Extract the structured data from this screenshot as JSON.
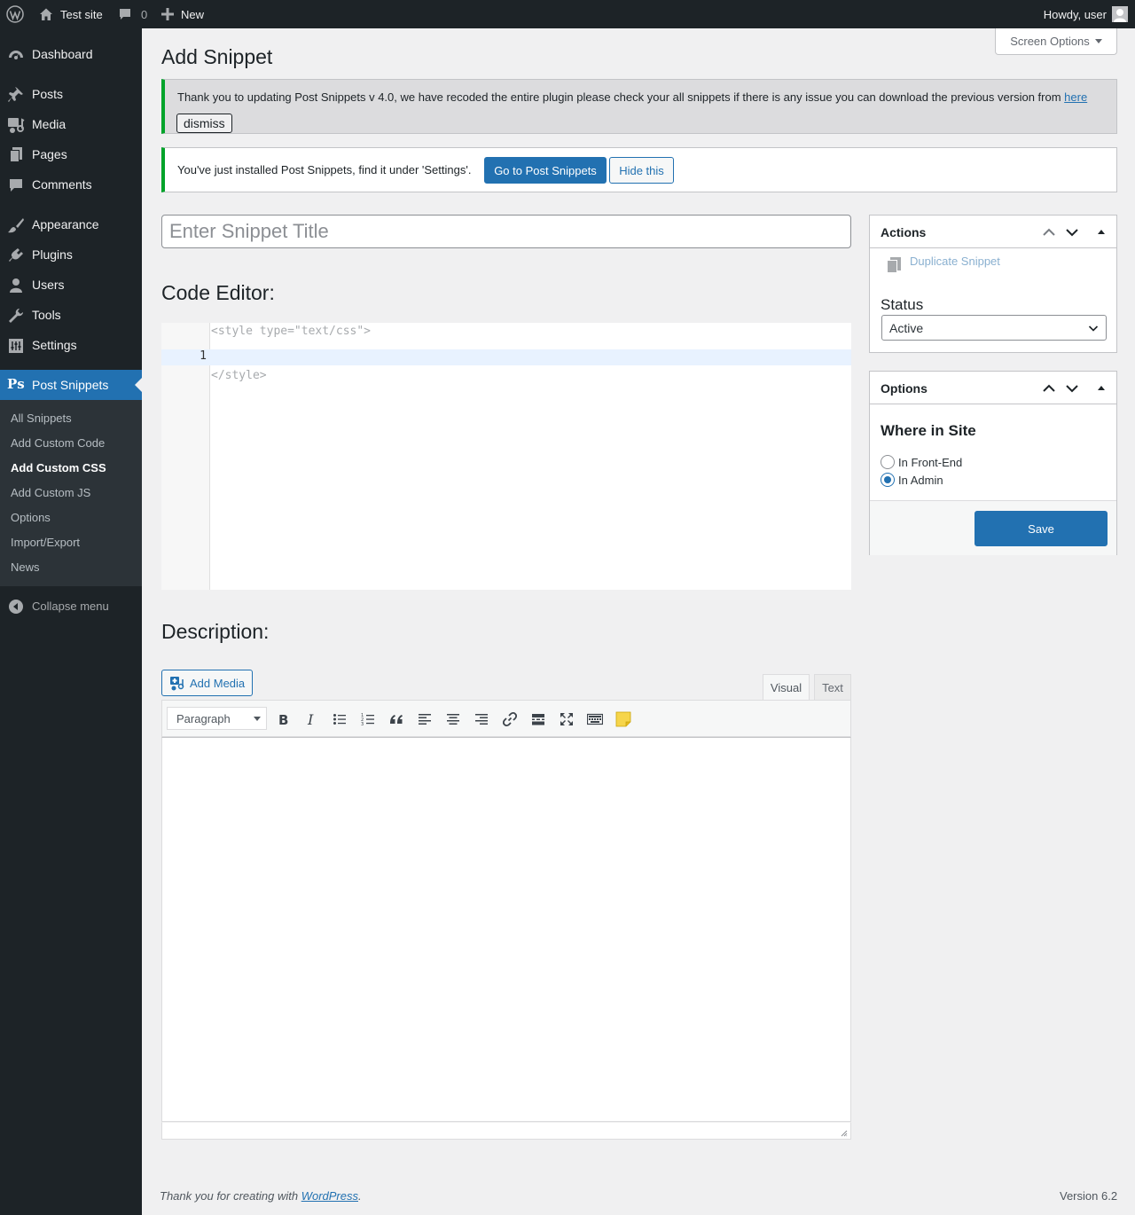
{
  "admin_bar": {
    "site_name": "Test site",
    "comments_count": "0",
    "new_label": "New",
    "howdy": "Howdy, user"
  },
  "sidebar": {
    "items": [
      {
        "label": "Dashboard",
        "icon": "dashboard-icon"
      },
      {
        "label": "Posts",
        "icon": "pin-icon"
      },
      {
        "label": "Media",
        "icon": "media-icon"
      },
      {
        "label": "Pages",
        "icon": "pages-icon"
      },
      {
        "label": "Comments",
        "icon": "comment-icon"
      },
      {
        "label": "Appearance",
        "icon": "brush-icon"
      },
      {
        "label": "Plugins",
        "icon": "plug-icon"
      },
      {
        "label": "Users",
        "icon": "user-icon"
      },
      {
        "label": "Tools",
        "icon": "wrench-icon"
      },
      {
        "label": "Settings",
        "icon": "settings-icon"
      },
      {
        "label": "Post Snippets",
        "icon_text": "Ps"
      }
    ],
    "submenu": [
      {
        "label": "All Snippets"
      },
      {
        "label": "Add Custom Code"
      },
      {
        "label": "Add Custom CSS"
      },
      {
        "label": "Add Custom JS"
      },
      {
        "label": "Options"
      },
      {
        "label": "Import/Export"
      },
      {
        "label": "News"
      }
    ],
    "collapse_label": "Collapse menu"
  },
  "header": {
    "screen_options": "Screen Options",
    "page_title": "Add Snippet"
  },
  "notices": {
    "upgrade_text": "Thank you to updating Post Snippets v 4.0, we have recoded the entire plugin please check your all snippets if there is any issue you can download the previous version from ",
    "upgrade_link": "here",
    "dismiss": "dismiss",
    "installed_text": "You've just installed Post Snippets, find it under 'Settings'.",
    "go_button": "Go to Post Snippets",
    "hide_button": "Hide this"
  },
  "editor": {
    "title_placeholder": "Enter Snippet Title",
    "code_heading": "Code Editor:",
    "code_prefix": "<style type=\"text/css\">",
    "code_suffix": "</style>",
    "line_number": "1",
    "description_heading": "Description:",
    "add_media": "Add Media",
    "tab_visual": "Visual",
    "tab_text": "Text",
    "format_value": "Paragraph"
  },
  "actions_box": {
    "title": "Actions",
    "duplicate_label": "Duplicate Snippet",
    "status_label": "Status",
    "status_value": "Active"
  },
  "options_box": {
    "title": "Options",
    "where_heading": "Where in Site",
    "radio_front": "In Front-End",
    "radio_admin": "In Admin",
    "selected": "In Admin",
    "save": "Save"
  },
  "footer": {
    "thanks_prefix": "Thank you for creating with ",
    "thanks_link": "WordPress",
    "thanks_suffix": ".",
    "version": "Version 6.2"
  },
  "colors": {
    "primary": "#2271b1",
    "admin_bar_bg": "#1d2327",
    "notice_success": "#00a32a"
  }
}
